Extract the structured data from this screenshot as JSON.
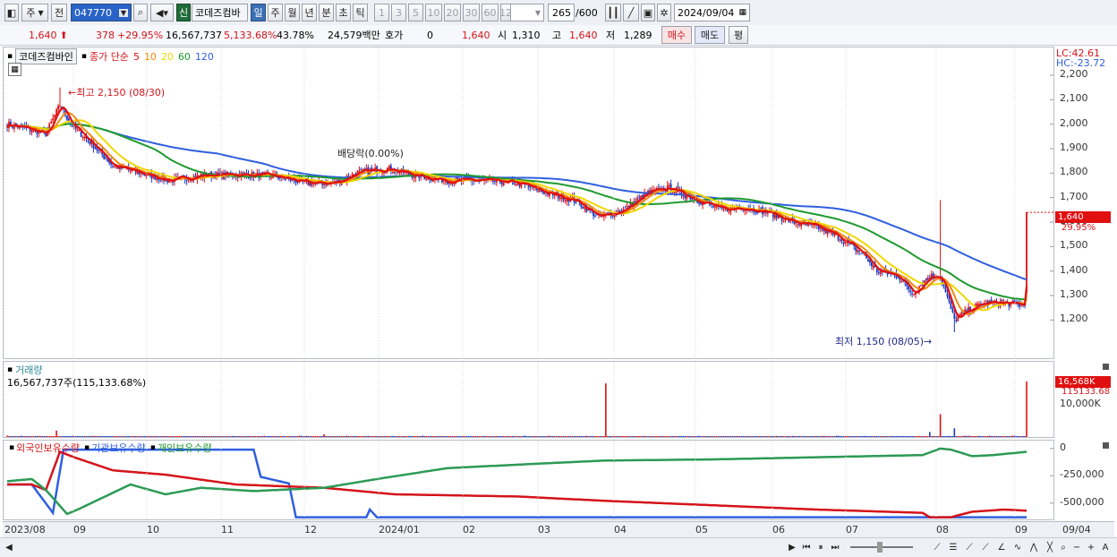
{
  "toolbar": {
    "period_type": "주",
    "prev_label": "전",
    "code": "047770",
    "new_label": "신",
    "stock_name": "코데즈컴바",
    "periods": [
      {
        "label": "일",
        "selected": true
      },
      {
        "label": "주",
        "selected": false
      },
      {
        "label": "월",
        "selected": false
      },
      {
        "label": "년",
        "selected": false
      },
      {
        "label": "분",
        "selected": false
      },
      {
        "label": "초",
        "selected": false
      },
      {
        "label": "틱",
        "selected": false
      }
    ],
    "intervals": [
      "1",
      "3",
      "5",
      "10",
      "20",
      "30",
      "60",
      "120"
    ],
    "count": "265",
    "count_total": "/600",
    "date": "2024/09/04"
  },
  "quote": {
    "price": "1,640",
    "change": "378",
    "change_pct": "+29.95%",
    "volume": "16,567,737",
    "volume_ratio": "5,133.68%",
    "turnover": "43.78%",
    "amount": "24,579백만",
    "hoga_label": "호가",
    "hoga_value": "0",
    "hoga_price": "1,640",
    "open_label": "시",
    "open": "1,310",
    "high_label": "고",
    "high": "1,640",
    "low_label": "저",
    "low": "1,289",
    "buy_label": "매수",
    "sell_label": "매도",
    "eval_label": "평"
  },
  "price_panel": {
    "name": "코데즈컴바인",
    "legend_label": "종가 단순",
    "ma": [
      {
        "label": "5",
        "color": "#e01010"
      },
      {
        "label": "10",
        "color": "#f08a10"
      },
      {
        "label": "20",
        "color": "#f0d800"
      },
      {
        "label": "60",
        "color": "#1e9a2e"
      },
      {
        "label": "120",
        "color": "#2f5fe0"
      }
    ],
    "lc": "LC:42.61",
    "hc": "HC:-23.72",
    "last_price": "1,640",
    "last_pct": "29.95%",
    "high_note": "최고 2,150 (08/30)",
    "low_note": "최저 1,150 (08/05)",
    "dividend_note": "배당락(0.00%)",
    "y_ticks": [
      "2,200",
      "2,100",
      "2,000",
      "1,900",
      "1,800",
      "1,700",
      "1,600",
      "1,500",
      "1,400",
      "1,300",
      "1,200"
    ]
  },
  "volume_panel": {
    "title": "거래량",
    "value": "16,567,737주(115,133.68%)",
    "tag_value": "16,568K",
    "tag_pct": "115133.68",
    "y_tick": "10,000K"
  },
  "holdings_panel": {
    "legend": [
      {
        "label": "외국인보유수량",
        "color": "#d4141a"
      },
      {
        "label": "기관보유수량",
        "color": "#2f5fe0"
      },
      {
        "label": "개인보유수량",
        "color": "#1e9a2e"
      }
    ],
    "y_ticks": [
      "0",
      "-250,000",
      "-500,000"
    ]
  },
  "x_labels": [
    "2023/08",
    "09",
    "10",
    "11",
    "12",
    "2024/01",
    "02",
    "03",
    "04",
    "05",
    "06",
    "07",
    "08",
    "09",
    "09/04"
  ],
  "chart_data": {
    "type": "line",
    "title": "코데즈컴바인",
    "price_range": [
      1150,
      2200
    ],
    "close_approx": [
      {
        "x": "2023/08",
        "y": 2000
      },
      {
        "x": "2023/08/30",
        "y": 2150
      },
      {
        "x": "2023/09",
        "y": 2000
      },
      {
        "x": "2023/10",
        "y": 1800
      },
      {
        "x": "2023/11",
        "y": 1790
      },
      {
        "x": "2023/12",
        "y": 1780
      },
      {
        "x": "2024/01",
        "y": 1800
      },
      {
        "x": "2024/02",
        "y": 1760
      },
      {
        "x": "2024/03",
        "y": 1650
      },
      {
        "x": "2024/04",
        "y": 1720
      },
      {
        "x": "2024/05",
        "y": 1660
      },
      {
        "x": "2024/06",
        "y": 1570
      },
      {
        "x": "2024/07",
        "y": 1380
      },
      {
        "x": "2024/08/05",
        "y": 1150
      },
      {
        "x": "2024/09",
        "y": 1262
      },
      {
        "x": "2024/09/04",
        "y": 1640
      }
    ],
    "volume_last": 16567737
  }
}
